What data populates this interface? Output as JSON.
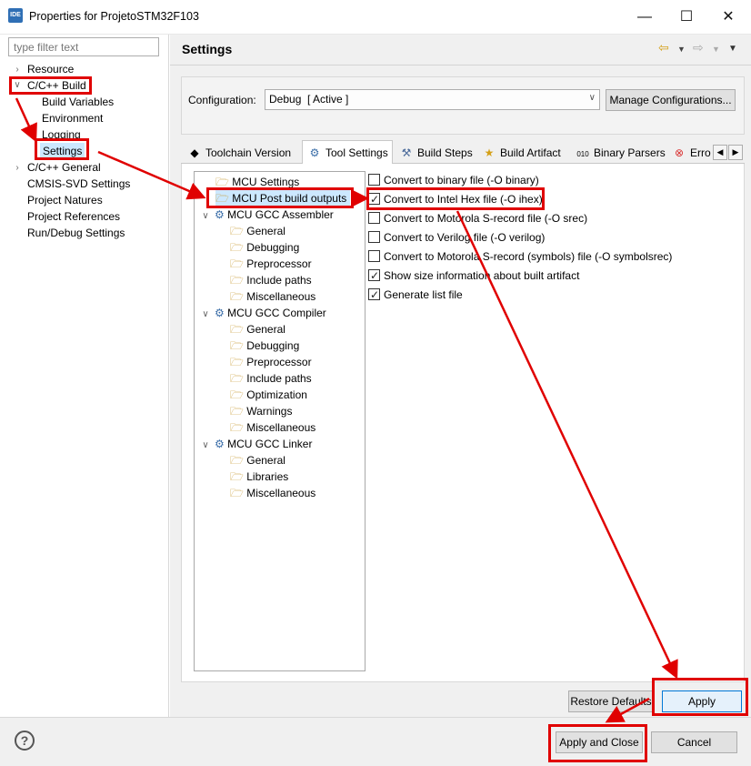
{
  "window": {
    "title": "Properties for ProjetoSTM32F103",
    "app_icon_text": "IDE",
    "minimize": "—",
    "maximize": "☐",
    "close": "✕"
  },
  "filter": {
    "placeholder": "type filter text"
  },
  "nav_tree": {
    "resource": "Resource",
    "cc_build": "C/C++ Build",
    "build_variables": "Build Variables",
    "environment": "Environment",
    "logging": "Logging",
    "settings": "Settings",
    "cc_general": "C/C++ General",
    "cmsis_svd": "CMSIS-SVD Settings",
    "project_natures": "Project Natures",
    "project_references": "Project References",
    "run_debug": "Run/Debug Settings"
  },
  "header": {
    "title": "Settings"
  },
  "config": {
    "label": "Configuration:",
    "value": "Debug  [ Active ]",
    "manage_button": "Manage Configurations..."
  },
  "tabs": [
    {
      "label": "Toolchain Version",
      "icon": "chip-icon"
    },
    {
      "label": "Tool Settings",
      "icon": "gear-icon"
    },
    {
      "label": "Build Steps",
      "icon": "hammer-icon"
    },
    {
      "label": "Build Artifact",
      "icon": "trophy-icon"
    },
    {
      "label": "Binary Parsers",
      "icon": "binary-icon"
    },
    {
      "label": "Erro",
      "icon": "error-icon"
    }
  ],
  "tool_tree": {
    "mcu_settings": "MCU Settings",
    "mcu_post_build": "MCU Post build outputs",
    "assembler": "MCU GCC Assembler",
    "asm_general": "General",
    "asm_debugging": "Debugging",
    "asm_preprocessor": "Preprocessor",
    "asm_include": "Include paths",
    "asm_misc": "Miscellaneous",
    "compiler": "MCU GCC Compiler",
    "cc_general": "General",
    "cc_debugging": "Debugging",
    "cc_preprocessor": "Preprocessor",
    "cc_include": "Include paths",
    "cc_optimization": "Optimization",
    "cc_warnings": "Warnings",
    "cc_misc": "Miscellaneous",
    "linker": "MCU GCC Linker",
    "ld_general": "General",
    "ld_libraries": "Libraries",
    "ld_misc": "Miscellaneous"
  },
  "options": [
    {
      "label": "Convert to binary file (-O binary)",
      "checked": false
    },
    {
      "label": "Convert to Intel Hex file (-O ihex)",
      "checked": true
    },
    {
      "label": "Convert to Motorola S-record file (-O srec)",
      "checked": false
    },
    {
      "label": "Convert to Verilog file (-O verilog)",
      "checked": false
    },
    {
      "label": "Convert to Motorola S-record (symbols) file (-O symbolsrec)",
      "checked": false
    },
    {
      "label": "Show size information about built artifact",
      "checked": true
    },
    {
      "label": "Generate list file",
      "checked": true
    }
  ],
  "buttons": {
    "restore_defaults": "Restore Defaults",
    "apply": "Apply",
    "apply_close": "Apply and Close",
    "cancel": "Cancel",
    "help": "?"
  },
  "colors": {
    "annotation_red": "#e00000",
    "selection_blue": "#cce8ff",
    "apply_border": "#0078d7"
  }
}
